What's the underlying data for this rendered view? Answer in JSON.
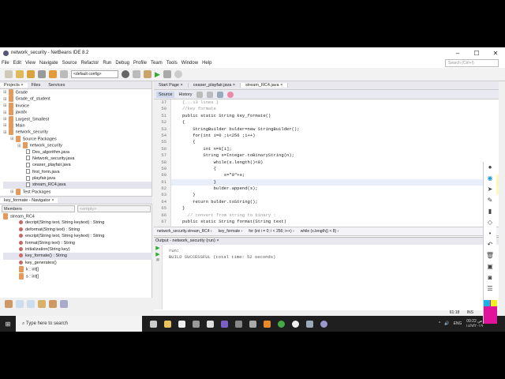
{
  "window": {
    "title": "network_security - NetBeans IDE 8.2",
    "min": "–",
    "max": "☐",
    "close": "✕"
  },
  "menu": [
    "File",
    "Edit",
    "View",
    "Navigate",
    "Source",
    "Refactor",
    "Run",
    "Debug",
    "Profile",
    "Team",
    "Tools",
    "Window",
    "Help"
  ],
  "toolbar": {
    "config": "<default config>",
    "search_placeholder": "Search (Ctrl+I)"
  },
  "projects": {
    "tabs": [
      "Projects ×",
      "Files",
      "Services"
    ],
    "items": [
      {
        "label": "Grade",
        "lvl": 0,
        "k": "p"
      },
      {
        "label": "Grade_of_student",
        "lvl": 0,
        "k": "p"
      },
      {
        "label": "Invoice",
        "lvl": 0,
        "k": "p"
      },
      {
        "label": "javafx",
        "lvl": 0,
        "k": "p"
      },
      {
        "label": "Largest_Smallest",
        "lvl": 0,
        "k": "p"
      },
      {
        "label": "Main",
        "lvl": 0,
        "k": "p"
      },
      {
        "label": "network_security",
        "lvl": 0,
        "k": "p"
      },
      {
        "label": "Source Packages",
        "lvl": 1,
        "k": "p"
      },
      {
        "label": "network_security",
        "lvl": 2,
        "k": "p"
      },
      {
        "label": "Des_algorithm.java",
        "lvl": 3,
        "k": "f"
      },
      {
        "label": "Network_security.java",
        "lvl": 3,
        "k": "f"
      },
      {
        "label": "ceaser_playfair.java",
        "lvl": 3,
        "k": "f"
      },
      {
        "label": "first_form.java",
        "lvl": 3,
        "k": "f"
      },
      {
        "label": "playfair.java",
        "lvl": 3,
        "k": "f"
      },
      {
        "label": "stream_RC4.java",
        "lvl": 3,
        "k": "f"
      },
      {
        "label": "Test Packages",
        "lvl": 1,
        "k": "p"
      }
    ]
  },
  "navigator": {
    "title": "key_formate - Navigator ×",
    "members": "Members",
    "filter": "<empty>",
    "root": "stream_RC4",
    "items": [
      "decript(String text, String keytext) : String",
      "deformat(String text) : String",
      "encript(String text, String keytext) : String",
      "format(String text) : String",
      "initialization(String key)",
      "key_formate() : String",
      "key_generates()",
      "k : int[]",
      "s : int[]"
    ]
  },
  "editor": {
    "tabs": [
      "Start Page ×",
      "ceaser_playfair.java ×",
      "stream_RC4.java ×"
    ],
    "source": "Source",
    "history": "History",
    "lines": [
      [
        "37",
        "{...13 lines }"
      ],
      [
        "50",
        "//key formate"
      ],
      [
        "51",
        "public static String key_formate()"
      ],
      [
        "52",
        "{"
      ],
      [
        "53",
        "    StringBuilder bulder=new StringBuilder();"
      ],
      [
        "54",
        "    for(int i=0 ;i<256 ;i++)"
      ],
      [
        "55",
        "    {"
      ],
      [
        "56",
        "        int n=k[i];"
      ],
      [
        "57",
        "        String s=Integer.toBinaryString(n);"
      ],
      [
        "58",
        "            while(s.length()<8)"
      ],
      [
        "59",
        "            {"
      ],
      [
        "60",
        "                s=\"0\"+s;"
      ],
      [
        "61",
        "            }"
      ],
      [
        "62",
        "            bulder.append(s);"
      ],
      [
        "63",
        "    }"
      ],
      [
        "64",
        "    return bulder.toString();"
      ],
      [
        "65",
        "}"
      ],
      [
        "66",
        "  // convert from string to binary :"
      ],
      [
        "67",
        "public static String format(String text)"
      ]
    ],
    "breadcrumb": [
      "network_security.stream_RC4 ›",
      "key_formate ›",
      "for (int i = 0; i < 256; i++) ›",
      "while (s.length() < 8) ›"
    ]
  },
  "output": {
    "title": "Output - network_security (run) ×",
    "lines": [
      "run:",
      "BUILD SUCCESSFUL (total time: 52 seconds)"
    ]
  },
  "status": {
    "position": "61:18",
    "mode": "INS"
  },
  "taskbar": {
    "search": "Type here to search",
    "lang": "ENG",
    "time": "09:22 ص",
    "date": "١٤/٧/٢٠١٩"
  }
}
